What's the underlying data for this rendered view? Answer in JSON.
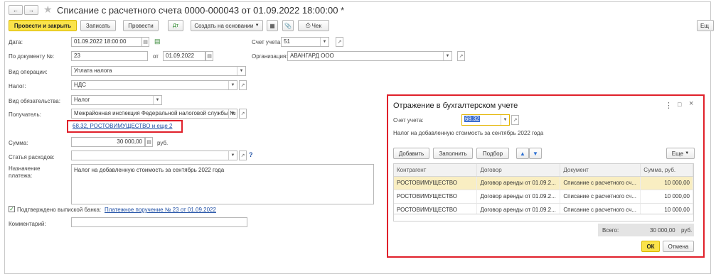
{
  "window": {
    "title": "Списание с расчетного счета 0000-000043 от 01.09.2022 18:00:00 *"
  },
  "toolbar": {
    "post_close": "Провести и закрыть",
    "save": "Записать",
    "post": "Провести",
    "create_based": "Создать на основании",
    "check": "Чек",
    "more": "Ещ"
  },
  "form": {
    "date_label": "Дата:",
    "date_value": "01.09.2022 18:00:00",
    "account_label": "Счет учета:",
    "account_value": "51",
    "doc_label": "По документу №:",
    "doc_value": "23",
    "from_label": "от",
    "doc_date": "01.09.2022",
    "org_label": "Организация:",
    "org_value": "АВАНГАРД ООО",
    "optype_label": "Вид операции:",
    "optype_value": "Уплата налога",
    "tax_label": "Налог:",
    "tax_value": "НДС",
    "obligation_label": "Вид обязательства:",
    "obligation_value": "Налог",
    "recipient_label": "Получатель:",
    "recipient_value": "Межрайонная инспекция Федеральной налоговой службы №",
    "accounting_link": "68.32, РОСТОВИМУЩЕСТВО и еще 2",
    "sum_label": "Сумма:",
    "sum_value": "30 000,00",
    "sum_currency": "руб.",
    "expense_label": "Статья расходов:",
    "expense_value": "",
    "help": "?",
    "purpose_label": "Назначение платежа:",
    "purpose_value": "Налог на добавленную стоимость за сентябрь 2022 года",
    "confirmed_label": "Подтверждено выпиской банка:",
    "confirmed_link": "Платежное поручение № 23 от 01.09.2022",
    "comment_label": "Комментарий:",
    "comment_value": ""
  },
  "dialog": {
    "title": "Отражение в бухгалтерском учете",
    "account_label": "Счет учета:",
    "account_value": "68.32",
    "description": "Налог на добавленную стоимость за сентябрь 2022 года",
    "add": "Добавить",
    "fill": "Заполнить",
    "select": "Подбор",
    "more": "Еще",
    "columns": [
      "Контрагент",
      "Договор",
      "Документ",
      "Сумма, руб."
    ],
    "rows": [
      {
        "contractor": "РОСТОВИМУЩЕСТВО",
        "contract": "Договор аренды от 01.09.2...",
        "document": "Списание с расчетного сч...",
        "sum": "10 000,00"
      },
      {
        "contractor": "РОСТОВИМУЩЕСТВО",
        "contract": "Договор аренды от 01.09.2...",
        "document": "Списание с расчетного сч...",
        "sum": "10 000,00"
      },
      {
        "contractor": "РОСТОВИМУЩЕСТВО",
        "contract": "Договор аренды от 01.09.2...",
        "document": "Списание с расчетного сч...",
        "sum": "10 000,00"
      }
    ],
    "total_label": "Всего:",
    "total_value": "30 000,00",
    "total_currency": "руб.",
    "ok": "ОК",
    "cancel": "Отмена"
  },
  "colors": {
    "primary_button": "#fbe34a",
    "link": "#1f4fa5",
    "highlight_border": "#e0202a",
    "selected_row": "#f9eec2"
  }
}
